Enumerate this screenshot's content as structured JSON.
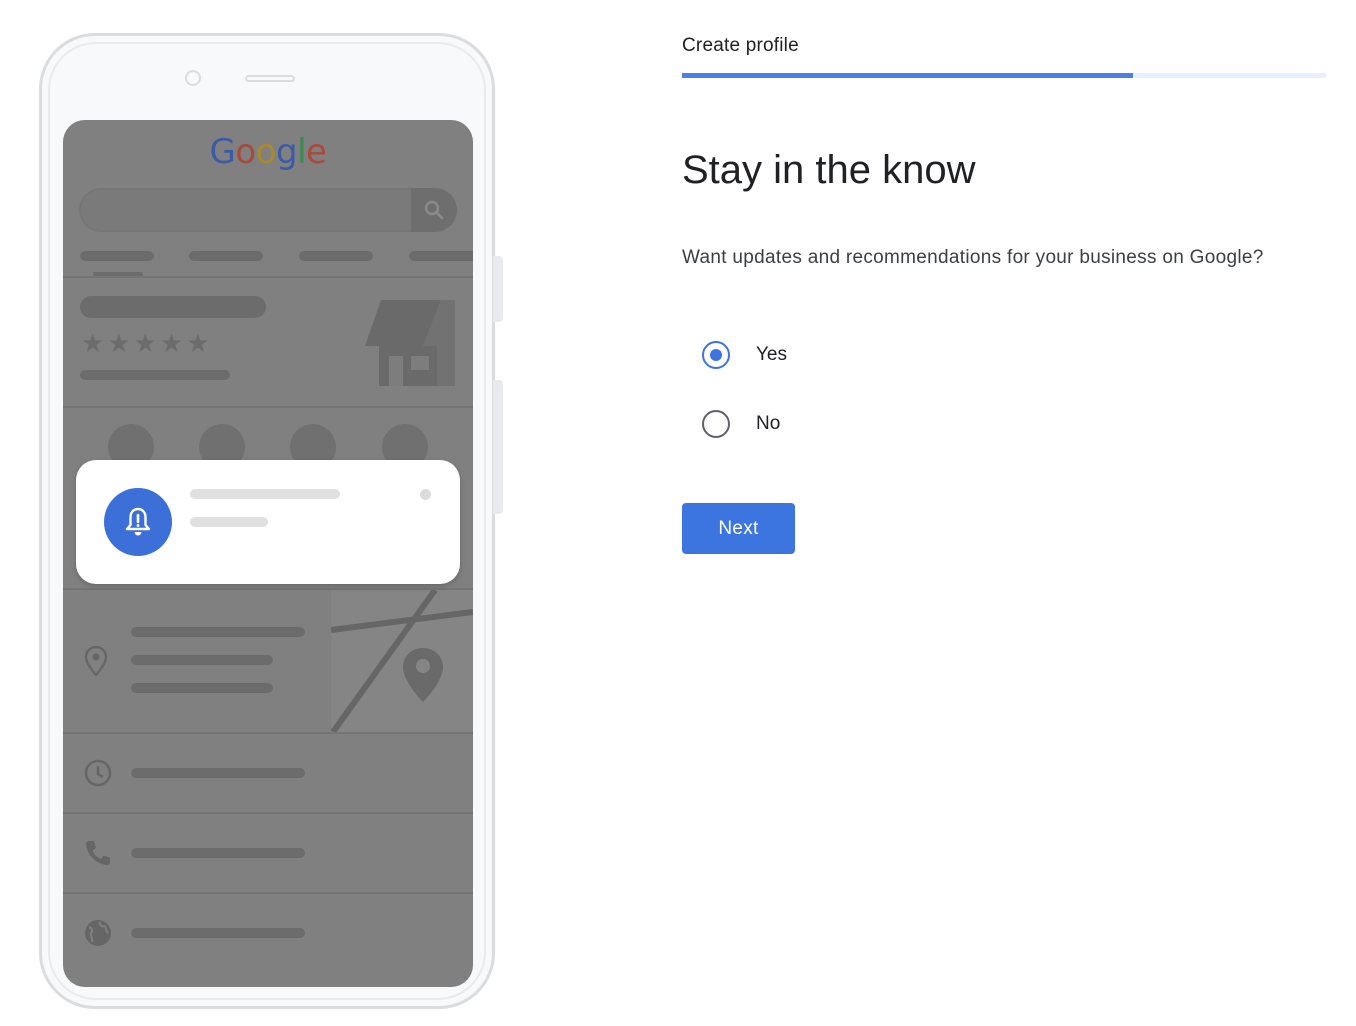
{
  "header": {
    "breadcrumb": "Create profile",
    "progress_fraction": 0.7
  },
  "main": {
    "title": "Stay in the know",
    "question": "Want updates and recommendations for your business on Google?",
    "options": [
      {
        "label": "Yes",
        "selected": true
      },
      {
        "label": "No",
        "selected": false
      }
    ],
    "next_label": "Next"
  },
  "illustration": {
    "logo_letters": [
      "G",
      "o",
      "o",
      "g",
      "l",
      "e"
    ],
    "rating_stars": "★★★★★",
    "icons": [
      "phone-icon",
      "directions-icon",
      "bookmark-icon",
      "website-icon",
      "bell-icon",
      "location-pin-icon",
      "clock-icon",
      "globe-icon"
    ]
  },
  "colors": {
    "accent": "#3c74e0",
    "progress_track": "#e8f0fe",
    "screen_overlay": "#808080"
  }
}
